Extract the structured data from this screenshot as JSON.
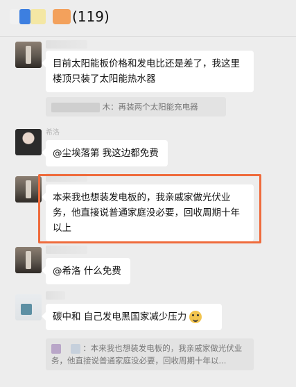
{
  "header": {
    "count": "(119)"
  },
  "messages": [
    {
      "text": "目前太阳能板价格和发电比还是差了，我这里楼顶只装了太阳能热水器"
    },
    {
      "quote": "木：再装两个太阳能充电器"
    },
    {
      "name": "希洛",
      "text": "@尘埃落第 我这边都免费"
    },
    {
      "text": "本来我也想装发电板的，我亲戚家做光伏业务，他直接说普通家庭没必要，回收周期十年以上"
    },
    {
      "text": "@希洛 什么免费"
    },
    {
      "text": "碳中和  自己发电黑国家减少压力"
    },
    {
      "quote": "：本来我也想装发电板的，我亲戚家做光伏业务，他直接说普通家庭没必要，回收周期十年以..."
    }
  ]
}
